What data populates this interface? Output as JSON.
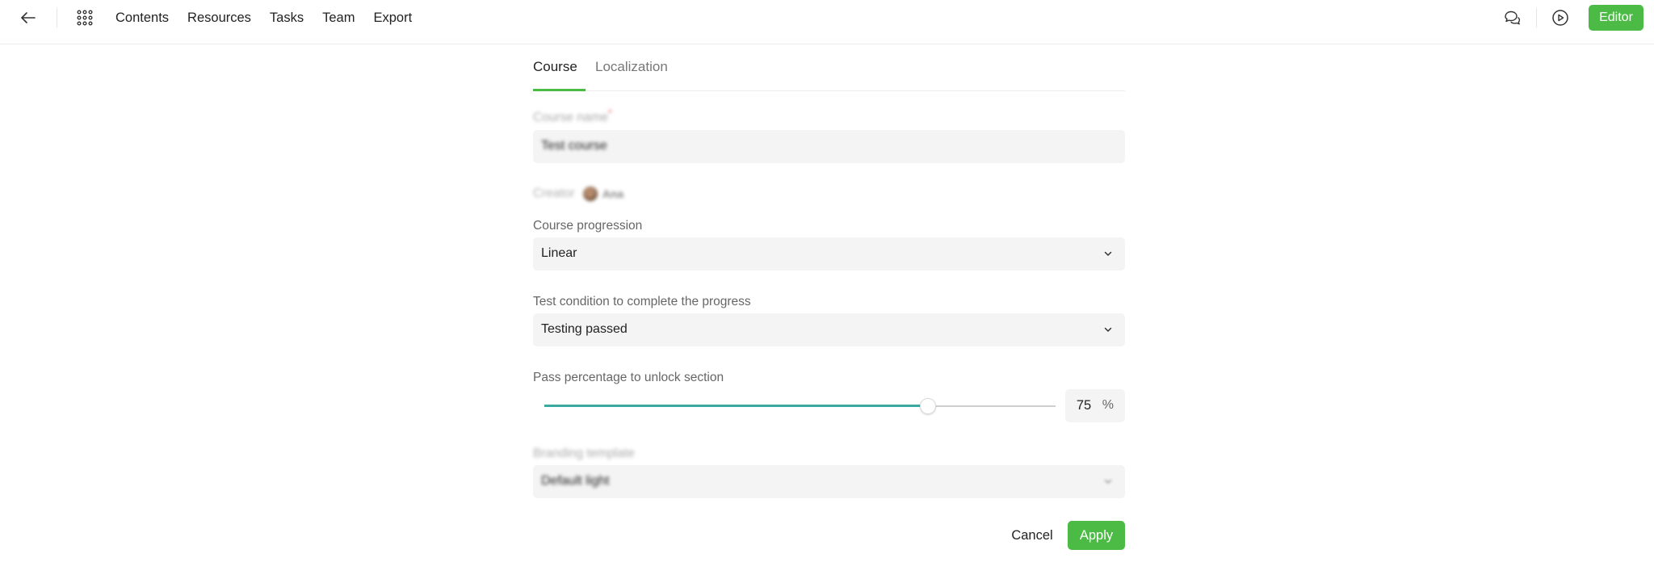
{
  "topbar": {
    "back_icon": "arrow-left-icon",
    "apps_icon": "grid-apps-icon",
    "nav": [
      {
        "label": "Contents"
      },
      {
        "label": "Resources"
      },
      {
        "label": "Tasks"
      },
      {
        "label": "Team"
      },
      {
        "label": "Export"
      }
    ],
    "comments_icon": "chat-bubbles-icon",
    "preview_icon": "play-circle-icon",
    "editor_label": "Editor"
  },
  "tabs": [
    {
      "label": "Course",
      "active": true
    },
    {
      "label": "Localization",
      "active": false
    }
  ],
  "form": {
    "course_name": {
      "label": "Course name",
      "required_mark": "*",
      "value": "Test course"
    },
    "creator": {
      "label": "Creator",
      "name": "Ana"
    },
    "progression": {
      "label": "Course progression",
      "value": "Linear"
    },
    "test_condition": {
      "label": "Test condition to complete the progress",
      "value": "Testing passed"
    },
    "pass_percentage": {
      "label": "Pass percentage to unlock section",
      "value": "75",
      "unit": "%",
      "fraction": 0.75
    },
    "branding": {
      "label": "Branding template",
      "value": "Default light"
    }
  },
  "actions": {
    "cancel_label": "Cancel",
    "apply_label": "Apply"
  },
  "colors": {
    "accent": "#4cbb46",
    "slider": "#3aa9a0",
    "field_bg": "#f4f4f4"
  }
}
